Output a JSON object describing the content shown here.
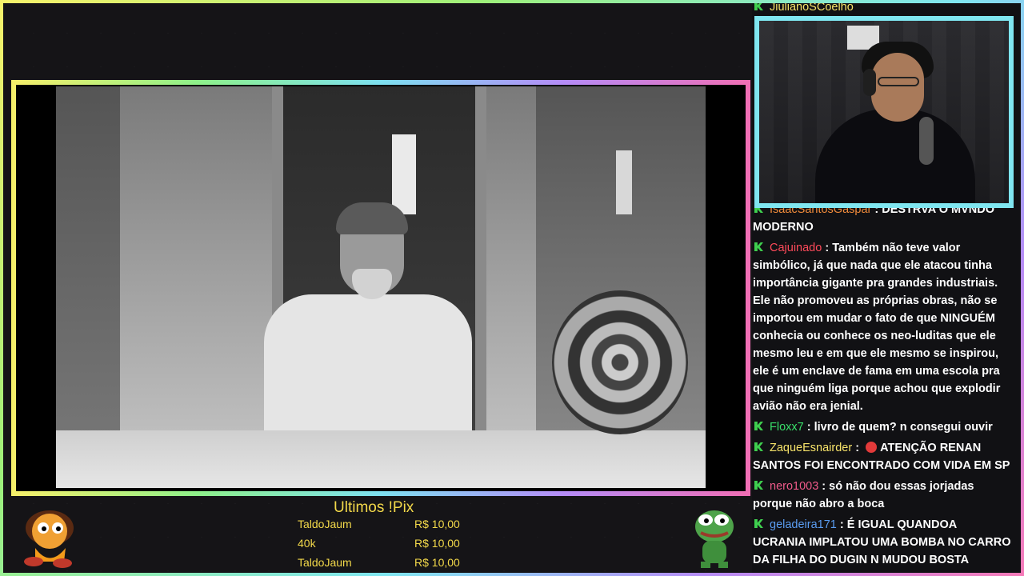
{
  "chat": {
    "partial_top": {
      "user": "JiulianoSCoelho",
      "text": ""
    },
    "messages": [
      {
        "user": "IsaacSantosGaspar",
        "user_color": "#f08a3a",
        "text": "DESTRVA O MVNDO MODERNO"
      },
      {
        "user": "Cajuinado",
        "user_color": "#ff4a5a",
        "text": "Também não teve valor simbólico, já que nada que ele atacou tinha importância gigante pra grandes industriais. Ele não promoveu as próprias obras, não se importou em mudar o fato de que NINGUÉM conhecia ou conhece os neo-luditas que ele mesmo leu e em que ele mesmo se inspirou, ele é um enclave de fama em uma escola pra que ninguém liga porque achou que explodir avião não era jenial."
      },
      {
        "user": "Floxx7",
        "user_color": "#39e06a",
        "text": "livro de quem? n consegui ouvir"
      },
      {
        "user": "ZaqueEsnairder",
        "user_color": "#f7e36a",
        "text": "ATENÇÃO RENAN SANTOS FOI ENCONTRADO COM VIDA EM SP",
        "emotes": true
      },
      {
        "user": "nero1003",
        "user_color": "#f05a8a",
        "text": "só não dou essas jorjadas porque não abro a boca"
      },
      {
        "user": "geladeira171",
        "user_color": "#5a9cf0",
        "text": "É IGUAL QUANDOA UCRANIA IMPLATOU UMA BOMBA NO CARRO DA FILHA DO DUGIN N MUDOU BOSTA NENHUMA KKKKKKK"
      }
    ]
  },
  "pix": {
    "title": "Ultimos !Pix",
    "rows": [
      {
        "name": "TaldoJaum",
        "amount": "R$ 10,00"
      },
      {
        "name": "40k",
        "amount": "R$ 10,00"
      },
      {
        "name": "TaldoJaum",
        "amount": "R$ 10,00"
      }
    ]
  },
  "colors": {
    "accent_cyan": "#7fe6f0",
    "pix_gold": "#f3d94a",
    "badge_green": "#3fd04f"
  }
}
